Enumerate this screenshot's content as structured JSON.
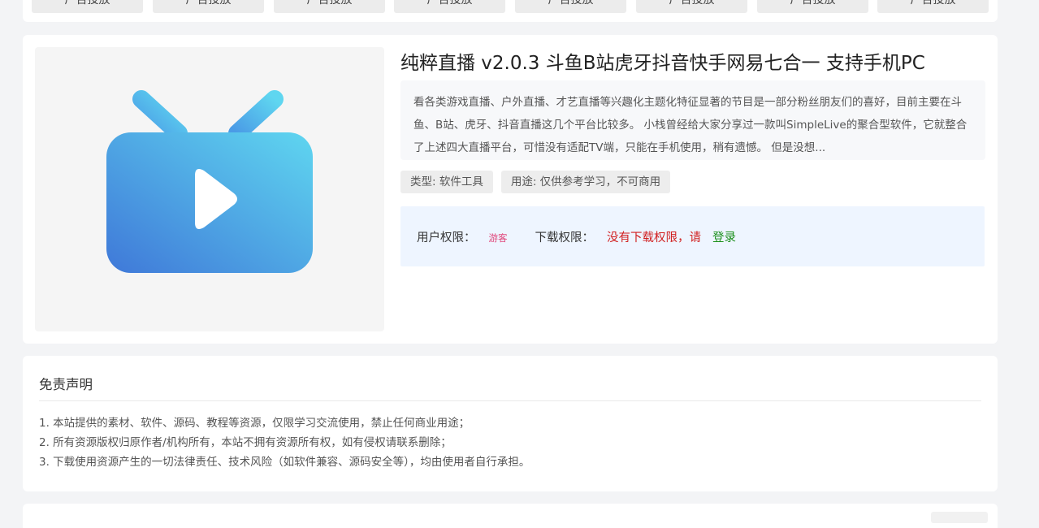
{
  "ads": {
    "items": [
      {
        "label": "广告投放"
      },
      {
        "label": "广告投放"
      },
      {
        "label": "广告投放"
      },
      {
        "label": "广告投放"
      },
      {
        "label": "广告投放"
      },
      {
        "label": "广告投放"
      },
      {
        "label": "广告投放"
      },
      {
        "label": "广告投放"
      }
    ]
  },
  "article": {
    "thumbnail_icon": "tv-play-icon",
    "title": "纯粹直播 v2.0.3 斗鱼B站虎牙抖音快手网易七合一 支持手机PC",
    "description": "看各类游戏直播、户外直播、才艺直播等兴趣化主题化特征显著的节目是一部分粉丝朋友们的喜好，目前主要在斗鱼、B站、虎牙、抖音直播这几个平台比较多。 小栈曾经给大家分享过一款叫SimpleLive的聚合型软件，它就整合了上述四大直播平台，可惜没有适配TV端，只能在手机使用，稍有遗憾。 但是没想...",
    "tags": {
      "type": "类型: 软件工具",
      "usage": "用途: 仅供参考学习，不可商用"
    },
    "permission": {
      "user_label": "用户权限：",
      "user_value": "游客",
      "download_label": "下载权限：",
      "download_value": "没有下载权限，请",
      "login_link": "登录"
    }
  },
  "disclaimer": {
    "title": "免责声明",
    "items": [
      "1. 本站提供的素材、软件、源码、教程等资源，仅限学习交流使用，禁止任何商业用途；",
      "2. 所有资源版权归原作者/机构所有，本站不拥有资源所有权，如有侵权请联系删除；",
      "3. 下载使用资源产生的一切法律责任、技术风险（如软件兼容、源码安全等），均由使用者自行承担。"
    ]
  },
  "colors": {
    "guest": "#e0457b",
    "deny": "#d11f1f",
    "login": "#1a8f1a",
    "tv_gradient_start": "#3f78d8",
    "tv_gradient_end": "#5fd6f0"
  }
}
